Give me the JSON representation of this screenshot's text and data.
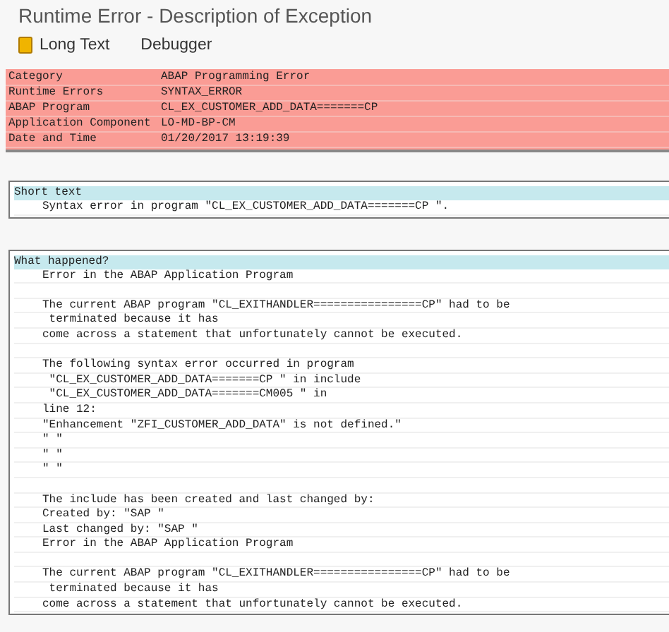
{
  "window": {
    "title": "Runtime Error - Description of Exception"
  },
  "toolbar": [
    {
      "kind": "icon-button",
      "label": "Long Text"
    },
    {
      "kind": "text-button",
      "label": "Debugger"
    }
  ],
  "header": [
    {
      "label": "Category",
      "value": "ABAP Programming Error"
    },
    {
      "label": "Runtime Errors",
      "value": "SYNTAX_ERROR"
    },
    {
      "label": "ABAP Program",
      "value": "CL_EX_CUSTOMER_ADD_DATA=======CP"
    },
    {
      "label": "Application Component",
      "value": "LO-MD-BP-CM"
    },
    {
      "label": "Date and Time",
      "value": "01/20/2017 13:19:39"
    }
  ],
  "sections": [
    {
      "title": "Short text",
      "paragraphs": [
        [
          "Syntax error in program \"CL_EX_CUSTOMER_ADD_DATA=======CP \"."
        ]
      ]
    },
    {
      "title": "What happened?",
      "paragraphs": [
        [
          "Error in the ABAP Application Program"
        ],
        [
          "The current ABAP program \"CL_EXITHANDLER================CP\" had to be",
          " terminated because it has",
          "come across a statement that unfortunately cannot be executed."
        ],
        [
          "The following syntax error occurred in program",
          " \"CL_EX_CUSTOMER_ADD_DATA=======CP \" in include",
          " \"CL_EX_CUSTOMER_ADD_DATA=======CM005 \" in",
          "line 12:",
          "\"Enhancement \"ZFI_CUSTOMER_ADD_DATA\" is not defined.\"",
          "\" \"",
          "\" \"",
          "\" \""
        ],
        [
          "The include has been created and last changed by:",
          "Created by: \"SAP \"",
          "Last changed by: \"SAP \"",
          "Error in the ABAP Application Program"
        ],
        [
          "The current ABAP program \"CL_EXITHANDLER================CP\" had to be",
          " terminated because it has",
          "come across a statement that unfortunately cannot be executed."
        ]
      ]
    }
  ]
}
